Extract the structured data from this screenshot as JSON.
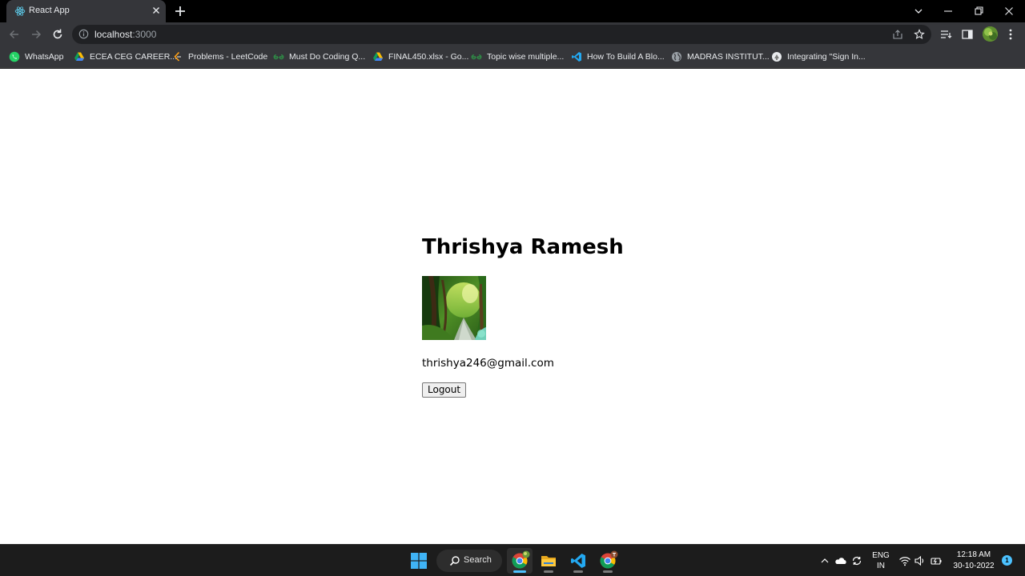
{
  "browser": {
    "tab": {
      "title": "React App",
      "favicon": "react-icon"
    },
    "address": {
      "host": "localhost",
      "port": ":3000"
    },
    "bookmarks": [
      {
        "label": "WhatsApp",
        "icon": "whatsapp-icon"
      },
      {
        "label": "ECEA CEG CAREER...",
        "icon": "google-drive-icon"
      },
      {
        "label": "Problems - LeetCode",
        "icon": "leetcode-icon"
      },
      {
        "label": "Must Do Coding Q...",
        "icon": "geeksforgeeks-icon"
      },
      {
        "label": "FINAL450.xlsx - Go...",
        "icon": "google-drive-icon"
      },
      {
        "label": "Topic wise multiple...",
        "icon": "geeksforgeeks-icon"
      },
      {
        "label": "How To Build A Blo...",
        "icon": "vscode-icon"
      },
      {
        "label": "MADRAS INSTITUT...",
        "icon": "globe-icon"
      },
      {
        "label": "Integrating \"Sign In...",
        "icon": "extension-icon"
      }
    ]
  },
  "page": {
    "user_name": "Thrishya Ramesh",
    "email": "thrishya246@gmail.com",
    "logout_label": "Logout",
    "photo_alt": "forest path photo"
  },
  "taskbar": {
    "search_label": "Search",
    "lang_line1": "ENG",
    "lang_line2": "IN",
    "time": "12:18 AM",
    "date": "30-10-2022",
    "notification_count": "1"
  },
  "colors": {
    "tabstrip": "#000000",
    "toolbar": "#35363a",
    "omnibox": "#202124",
    "taskbar": "#1c1c1c",
    "accent": "#4cc2ff"
  }
}
